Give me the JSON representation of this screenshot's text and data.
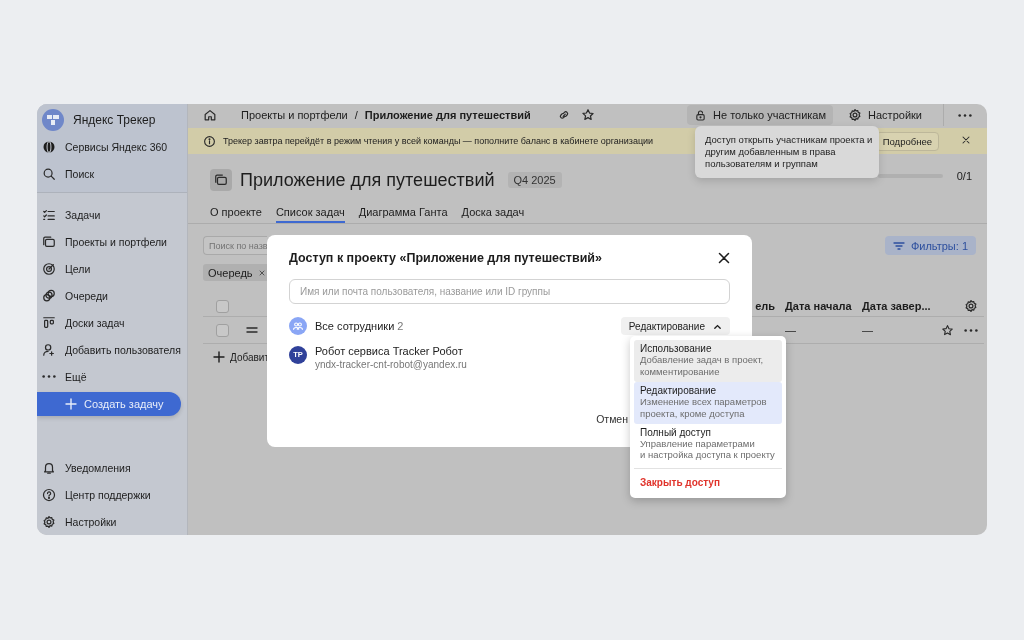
{
  "sidebar": {
    "brand": "Яндекс Трекер",
    "top_items": [
      {
        "label": "Сервисы Яндекс 360"
      },
      {
        "label": "Поиск"
      }
    ],
    "items": [
      {
        "label": "Задачи"
      },
      {
        "label": "Проекты и портфели"
      },
      {
        "label": "Цели"
      },
      {
        "label": "Очереди"
      },
      {
        "label": "Доски задач"
      },
      {
        "label": "Добавить пользователя"
      },
      {
        "label": "Ещё"
      }
    ],
    "create_button": "Создать задачу",
    "bottom_items": [
      {
        "label": "Уведомления"
      },
      {
        "label": "Центр поддержки"
      },
      {
        "label": "Настройки"
      }
    ]
  },
  "breadcrumbs": [
    {
      "label": "Проекты и портфели",
      "current": false
    },
    {
      "label": "Приложение для путешествий",
      "current": true
    }
  ],
  "breadcrumb_separator": "/",
  "header_actions": [
    {
      "kind": "access",
      "label": "Не только участникам"
    },
    {
      "kind": "settings",
      "label": "Настройки"
    }
  ],
  "banner": {
    "text": "Трекер завтра перейдёт в режим чтения у всей команды — пополните баланс в кабинете организации",
    "button": "Подробнее"
  },
  "tooltip": "Доступ открыть участникам проекта и\nдругим добавленным в права\nпользователям и группам",
  "project": {
    "title": "Приложение для путешествий",
    "badge": "Q4 2025",
    "progress": {
      "level": 0,
      "reading": "0/1"
    }
  },
  "tabs": [
    {
      "label": "О проекте",
      "selected": false
    },
    {
      "label": "Список задач",
      "selected": true
    },
    {
      "label": "Диаграмма Ганта",
      "selected": false
    },
    {
      "label": "Доска задач",
      "selected": false
    }
  ],
  "search": {
    "placeholder": "Поиск по назв"
  },
  "filters_button": "Фильтры: 1",
  "chips": [
    {
      "label": "Очередь"
    }
  ],
  "table": {
    "columns": [
      {
        "label": "ель"
      },
      {
        "label": "Дата начала"
      },
      {
        "label": "Дата завер..."
      }
    ],
    "select_all_checked": false,
    "rows": [
      {
        "checked": false,
        "cells": [
          "",
          "—",
          "—"
        ],
        "starred": false
      }
    ]
  },
  "add_task": "Добавит",
  "modal": {
    "title": "Доступ к проекту «Приложение для путешествий»",
    "search": {
      "placeholder": "Имя или почта пользователя, название или ID группы"
    },
    "members": [
      {
        "kind": "group",
        "name": "Все сотрудники",
        "count": "2",
        "role": "Редактирование",
        "expanded": true
      },
      {
        "kind": "user",
        "initials": "ТР",
        "name": "Робот сервиса Tracker Робот",
        "email": "yndx-tracker-cnt-robot@yandex.ru"
      }
    ],
    "cancel_button": "Отмен"
  },
  "role_menu": [
    {
      "kind": "option",
      "title": "Использование",
      "description": "Добавление задач в проект,\nкомментирование",
      "selected": false,
      "hovered": true
    },
    {
      "kind": "option",
      "title": "Редактирование",
      "description": "Изменение всех параметров\nпроекта, кроме доступа",
      "selected": true,
      "hovered": false
    },
    {
      "kind": "option",
      "title": "Полный доступ",
      "description": "Управление параметрами\nи настройка доступа к проекту",
      "selected": false,
      "hovered": false
    },
    {
      "kind": "danger",
      "title": "Закрыть доступ"
    }
  ]
}
